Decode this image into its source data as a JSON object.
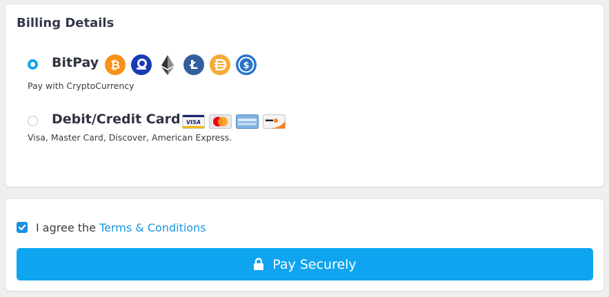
{
  "billing": {
    "title": "Billing Details",
    "options": [
      {
        "label": "BitPay",
        "description": "Pay with CryptoCurrency",
        "selected": true,
        "icons": [
          "bitcoin-icon",
          "bitpay-coin-icon",
          "ethereum-icon",
          "litecoin-icon",
          "dai-icon",
          "usdc-icon"
        ]
      },
      {
        "label": "Debit/Credit Card",
        "description": "Visa, Master Card, Discover, American Express.",
        "selected": false,
        "icons": [
          "visa-card-icon",
          "mastercard-card-icon",
          "american-express-card-icon",
          "discover-card-icon"
        ]
      }
    ]
  },
  "payment": {
    "terms_prefix": "I agree the ",
    "terms_link": "Terms & Conditions",
    "terms_checked": true,
    "button_label": "Pay Securely",
    "button_icon": "lock-icon"
  },
  "colors": {
    "accent": "#0fa4f0",
    "link": "#1a95e0",
    "title": "#33384a"
  }
}
